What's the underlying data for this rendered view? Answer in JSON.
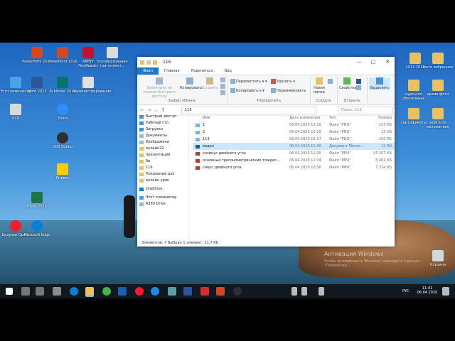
{
  "desktop": {
    "left_icons": [
      {
        "label": "Этот компьютер",
        "color": "#4aa3e6"
      },
      {
        "label": "PowerPoint 2013",
        "color": "#d24726"
      },
      {
        "label": "OCR",
        "color": "#d9d9d9"
      },
      {
        "label": "Word 2013",
        "color": "#2b579a"
      },
      {
        "label": "Excel 2013",
        "color": "#217346"
      },
      {
        "label": "Браузер Opera",
        "color": "#ff1b2d"
      },
      {
        "label": "Microsoft Edge",
        "color": "#0a7fd1"
      },
      {
        "label": "Zoom",
        "color": "#2d8cff"
      },
      {
        "label": "Яндекс",
        "color": "#ffcc00"
      },
      {
        "label": "OBS Studio",
        "color": "#302e31"
      }
    ],
    "top_icons": [
      {
        "label": "Publisher 2016",
        "color": "#077568"
      },
      {
        "label": "PowerPoint 2016",
        "color": "#d24726"
      },
      {
        "label": "ABBYY FineReader",
        "color": "#c8102e"
      },
      {
        "label": "Администрирование",
        "color": "#e0e0e0"
      },
      {
        "label": "преобразование тригономет...",
        "color": "#dcdcdc"
      }
    ],
    "right_icons": [
      {
        "label": "2017-2018",
        "color": "#e8c165"
      },
      {
        "label": "фото избранное",
        "color": "#e8c165"
      },
      {
        "label": "курсы по обновление",
        "color": "#e8c165"
      },
      {
        "label": "архив фото",
        "color": "#e8c165"
      },
      {
        "label": "сертификаты",
        "color": "#e8c165"
      },
      {
        "label": "книги по математике",
        "color": "#e8c165"
      },
      {
        "label": "Корзина",
        "color": "#cfd8dc"
      }
    ],
    "activation": {
      "title": "Активация Windows",
      "text": "Чтобы активировать Windows, перейдите в раздел \"Параметры\"."
    }
  },
  "explorer": {
    "title": "116",
    "tabs": [
      "Файл",
      "Главная",
      "Поделиться",
      "Вид"
    ],
    "ribbon": {
      "pin": "Закрепить на панели быстрого доступа",
      "copy": "Копировать",
      "paste": "Вставить",
      "cut": "Вырезать",
      "copy_path": "Скопировать путь",
      "paste_shortcut": "Вставить ярлык",
      "move_to": "Переместить в",
      "copy_to": "Копировать в",
      "delete": "Удалить",
      "rename": "Переименовать",
      "new_folder": "Новая папка",
      "properties": "Свойства",
      "select": "Выделить",
      "group_clipboard": "Буфер обмена",
      "group_organize": "Упорядочить",
      "group_create": "Создать",
      "group_open": "Открыть"
    },
    "address": "116",
    "search_placeholder": "Поиск: 116",
    "nav": [
      "Быстрый доступ",
      "Рабочий сто",
      "Загрузки",
      "Документы",
      "Изображени",
      "онлайн22",
      "презентации",
      "9в",
      "116",
      "Локальный дис",
      "онлайн урок",
      "OneDrive",
      "Этот компьютер",
      "A360 Drive"
    ],
    "columns": [
      "Имя",
      "Дата изменения",
      "Тип",
      "Размер"
    ],
    "files": [
      {
        "name": "1",
        "date": "06.04.2020 10:28",
        "type": "Файл \"PNG\"",
        "size": "153 КБ",
        "icon": "#7ab4e8"
      },
      {
        "name": "2",
        "date": "06.04.2020 10:18",
        "type": "Файл \"PNG\"",
        "size": "13 КБ",
        "icon": "#7ab4e8"
      },
      {
        "name": "113",
        "date": "06.04.2020 10:17",
        "type": "Файл \"PNG\"",
        "size": "150 КБ",
        "icon": "#7ab4e8"
      },
      {
        "name": "видео",
        "date": "06.04.2020 11:30",
        "type": "Документ Micros...",
        "size": "12 КБ",
        "icon": "#2b579a"
      },
      {
        "name": "косинус двойного угла",
        "date": "06.04.2020 11:00",
        "type": "Файл \"MP4\"",
        "size": "33 207 КБ",
        "icon": "#c0392b"
      },
      {
        "name": "основные тригонометрические тождес...",
        "date": "06.04.2020 11:04",
        "type": "Файл \"MP4\"",
        "size": "8 481 КБ",
        "icon": "#c0392b"
      },
      {
        "name": "синус двойного угла",
        "date": "06.04.2020 10:56",
        "type": "Файл \"MP4\"",
        "size": "7 314 КБ",
        "icon": "#c0392b"
      }
    ],
    "status": "Элементов: 7      Выбран 1 элемент: 11,7 КБ"
  },
  "taskbar": {
    "lang": "РУС",
    "time": "11:41",
    "date": "06.04.2020"
  }
}
